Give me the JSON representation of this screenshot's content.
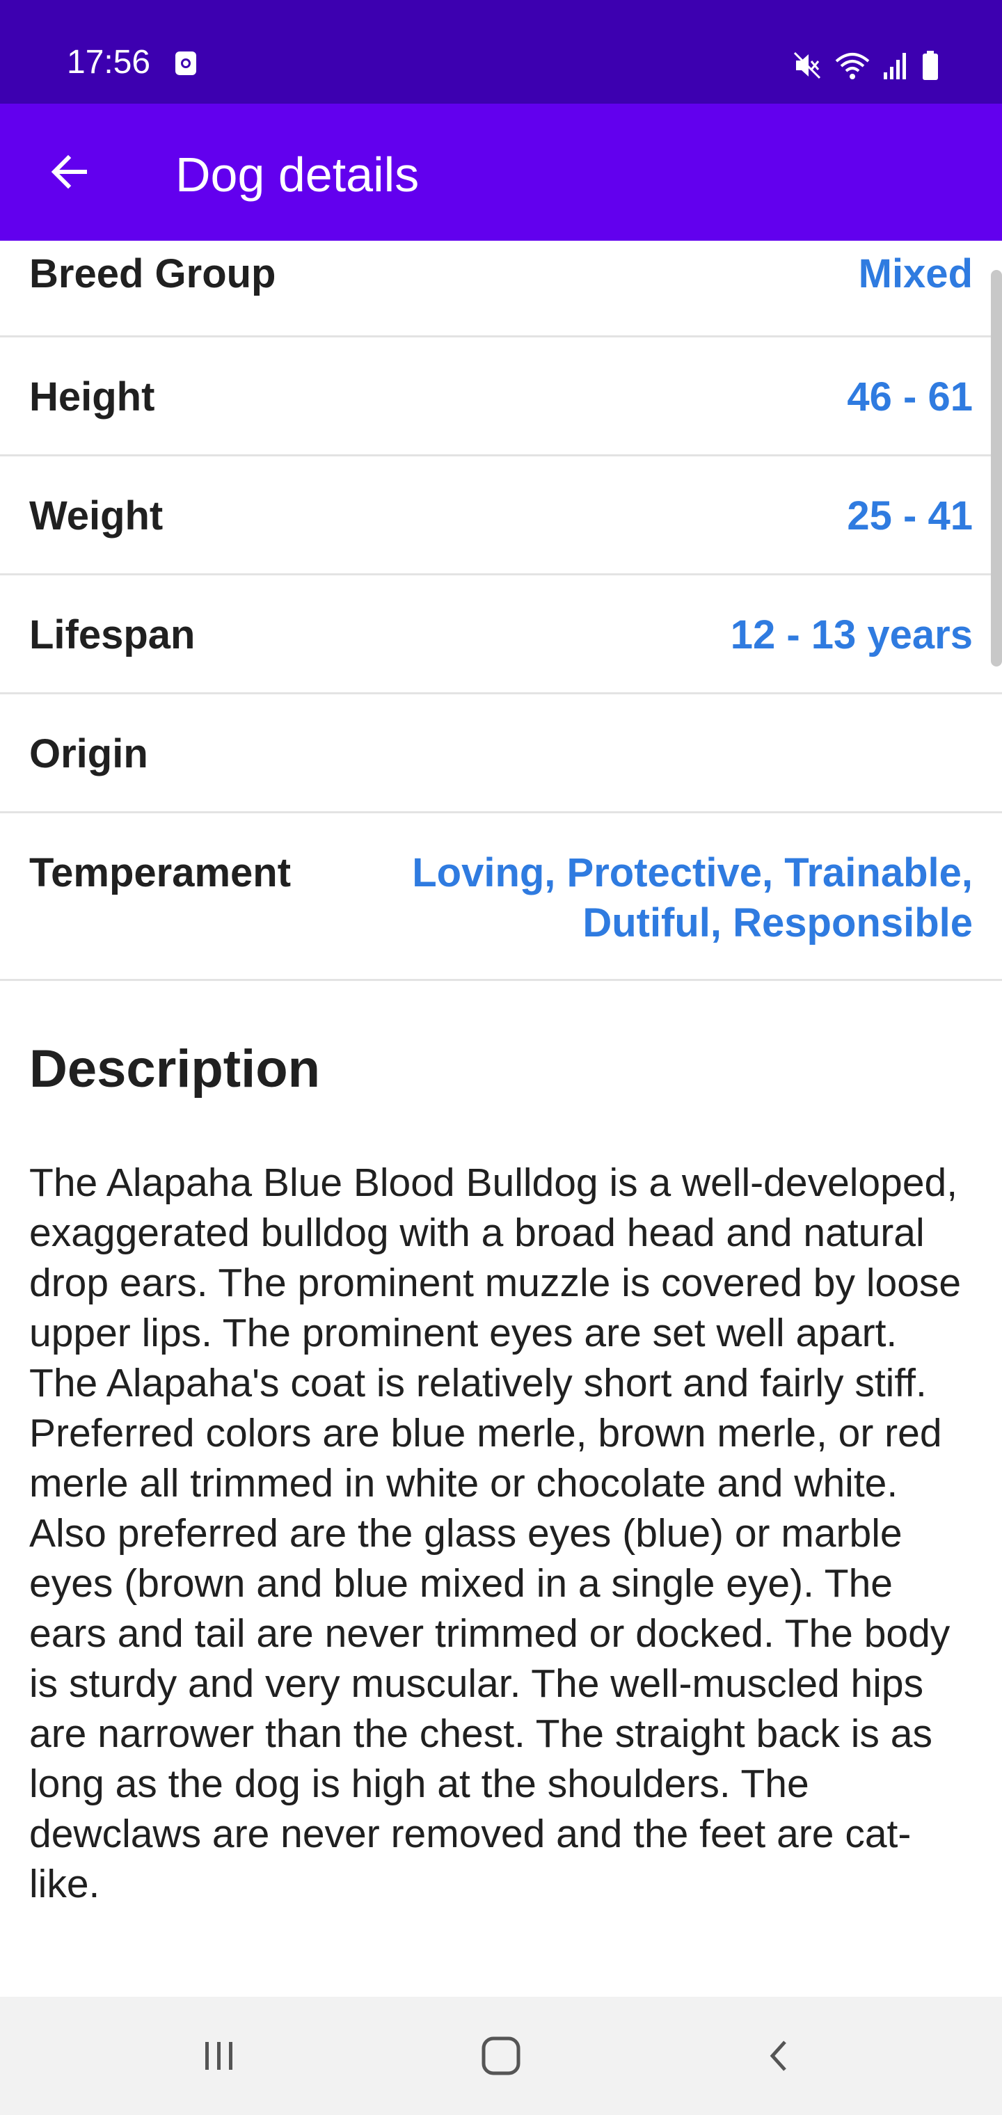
{
  "status_bar": {
    "time": "17:56",
    "icons": [
      "notification-app-icon",
      "mute-icon",
      "wifi-icon",
      "signal-icon",
      "battery-icon"
    ]
  },
  "app_bar": {
    "back_icon": "arrow-left-icon",
    "title": "Dog details"
  },
  "details": [
    {
      "label": "Breed Group",
      "value": "Mixed"
    },
    {
      "label": "Height",
      "value": "46 - 61"
    },
    {
      "label": "Weight",
      "value": "25 - 41"
    },
    {
      "label": "Lifespan",
      "value": "12 - 13 years"
    },
    {
      "label": "Origin",
      "value": ""
    },
    {
      "label": "Temperament",
      "value": "Loving, Protective, Trainable, Dutiful, Responsible"
    }
  ],
  "description": {
    "title": "Description",
    "text": "The Alapaha Blue Blood Bulldog is a well-developed, exaggerated bulldog with a broad head and natural drop ears. The prominent muzzle is covered by loose upper lips. The prominent eyes are set well apart. The Alapaha's coat is relatively short and fairly stiff. Preferred colors are blue merle, brown merle, or red merle all trimmed in white or chocolate and white. Also preferred are the glass eyes (blue) or marble eyes (brown and blue mixed in a single eye). The ears and tail are never trimmed or docked. The body is sturdy and very muscular. The well-muscled hips are narrower than the chest. The straight back is as long as the dog is high at the shoulders. The dewclaws are never removed and the feet are cat-like."
  },
  "nav_bar": {
    "buttons": [
      "recent-apps-icon",
      "home-icon",
      "back-icon"
    ]
  },
  "colors": {
    "status_bar": "#3d00b0",
    "app_bar": "#6200ee",
    "value_text": "#2f7be0"
  }
}
